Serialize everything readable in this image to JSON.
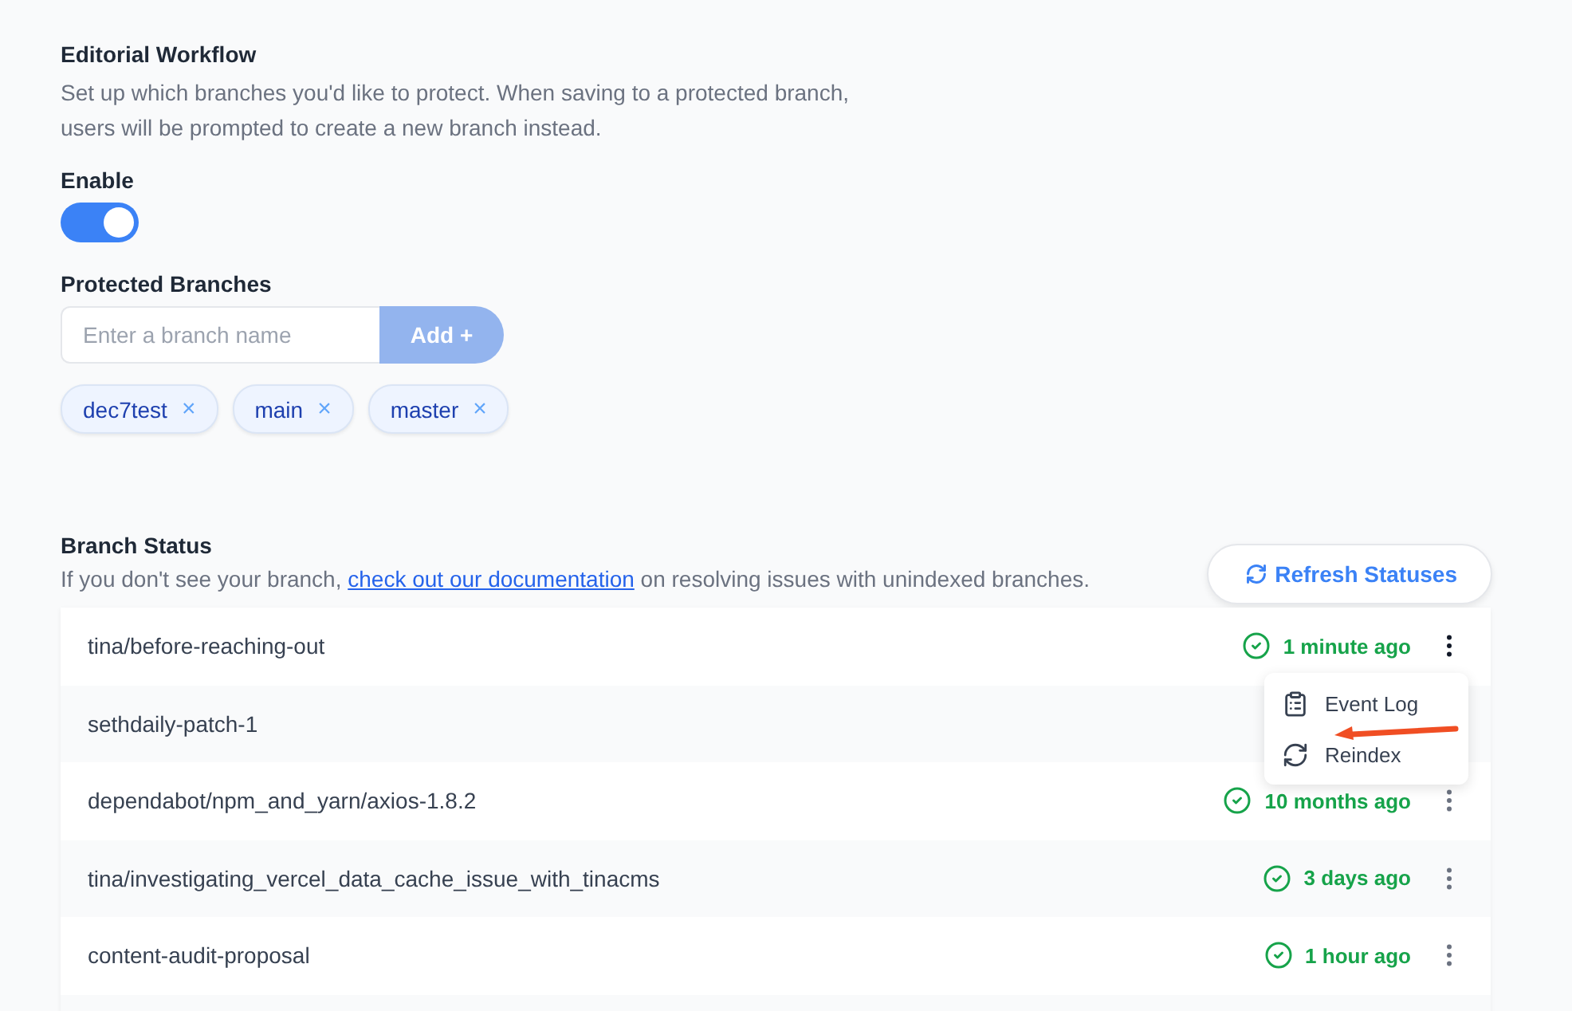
{
  "workflow": {
    "title": "Editorial Workflow",
    "description": "Set up which branches you'd like to protect. When saving to a protected branch, users will be prompted to create a new branch instead.",
    "enable": {
      "label": "Enable",
      "on": true
    }
  },
  "protected": {
    "label": "Protected Branches",
    "placeholder": "Enter a branch name",
    "add_button": {
      "label": "Add +",
      "disabled": true
    },
    "tags": [
      {
        "label": "dec7test",
        "remove": "×"
      },
      {
        "label": "main",
        "remove": "×"
      },
      {
        "label": "master",
        "remove": "×"
      }
    ]
  },
  "branch_status": {
    "title": "Branch Status",
    "text_before": "If you don't see your branch,",
    "link": "check out our documentation",
    "text_after": "on resolving issues with unindexed branches.",
    "refresh_button": "Refresh Statuses",
    "rows": [
      {
        "name": "tina/before-reaching-out",
        "status": "1 minute ago",
        "menu_open": true
      },
      {
        "name": "sethdaily-patch-1",
        "menu_open": false
      },
      {
        "name": "dependabot/npm_and_yarn/axios-1.8.2",
        "status": "10 months ago",
        "menu_open": false
      },
      {
        "name": "tina/investigating_vercel_data_cache_issue_with_tinacms",
        "status": "3 days ago",
        "menu_open": false
      },
      {
        "name": "content-audit-proposal",
        "status": "1 hour ago",
        "menu_open": false
      }
    ],
    "menu": [
      {
        "kind": "log",
        "label": "Event Log"
      },
      {
        "kind": "reindex",
        "label": "Reindex"
      }
    ]
  }
}
